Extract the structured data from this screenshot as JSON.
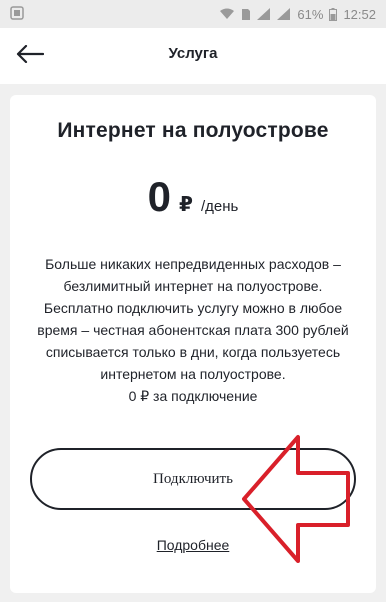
{
  "statusbar": {
    "battery_percent": "61%",
    "time": "12:52"
  },
  "appbar": {
    "title": "Услуга"
  },
  "service": {
    "title": "Интернет на полуострове",
    "price_value": "0",
    "price_currency": "₽",
    "price_unit": "/день",
    "description": "Больше никаких непредвиденных расходов – безлимитный интернет на полуострове. Бесплатно подключить услугу можно в любое время – честная абонентская плата 300 рублей списывается только в дни, когда пользуетесь интернетом на полуострове.",
    "connection_fee": "0 ₽ за подключение"
  },
  "actions": {
    "connect_label": "Подключить",
    "more_label": "Подробнее"
  },
  "colors": {
    "text": "#1f2229",
    "annotation_arrow": "#d9202a",
    "background": "#f0f0f0"
  }
}
